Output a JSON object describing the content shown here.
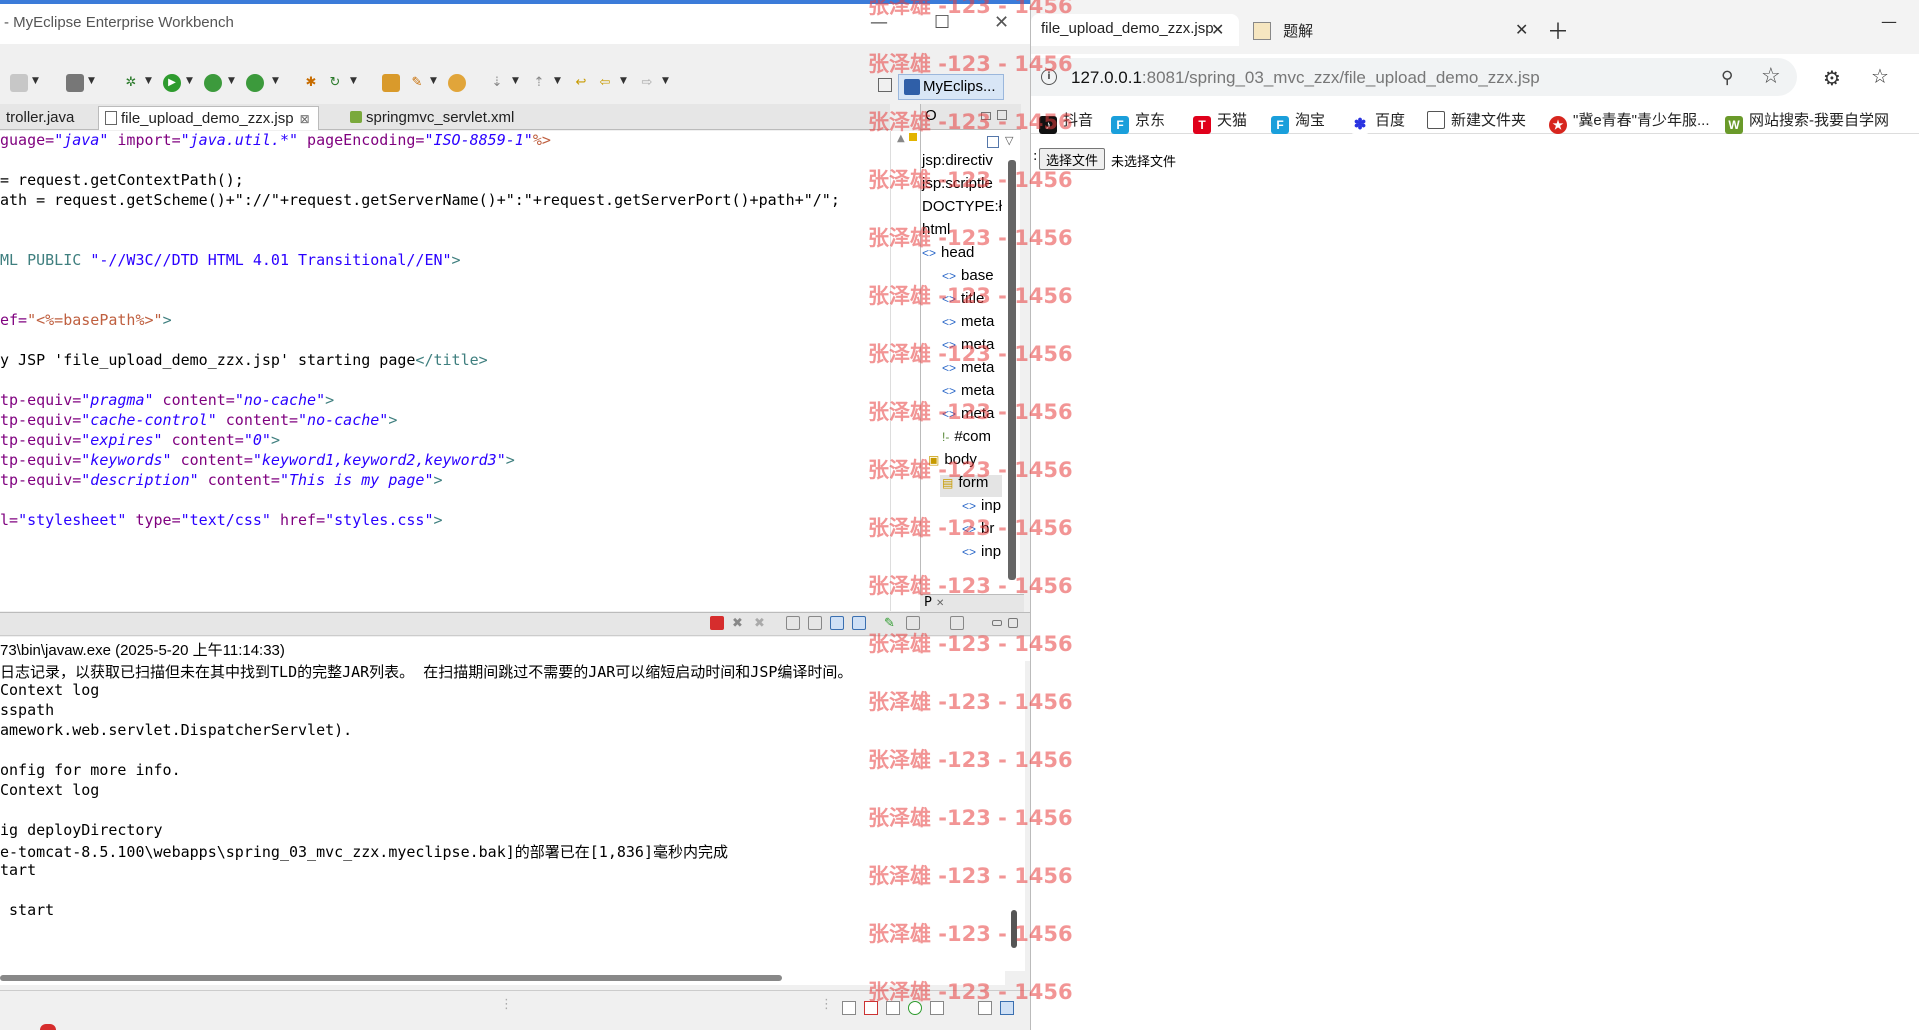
{
  "eclipse": {
    "title": "MyEclipse Enterprise Workbench",
    "perspective_label": "MyEclips...",
    "tabs": [
      {
        "label": "troller.java"
      },
      {
        "label": "file_upload_demo_zzx.jsp"
      },
      {
        "label": "springmvc_servlet.xml"
      }
    ],
    "outline_title": "O",
    "outline_items": [
      "jsp:directiv",
      "jsp:scriptle",
      "DOCTYPE:ł",
      "html",
      "head",
      "base",
      "title",
      "meta",
      "meta",
      "meta",
      "meta",
      "meta",
      "#com",
      "body",
      "form",
      "inp",
      "br",
      "inp"
    ],
    "bottom_tab": "P",
    "console_header": "73\\bin\\javaw.exe (2025-5-20 上午11:14:33)",
    "console_lines": [
      "日志记录，以获取已扫描但未在其中找到TLD的完整JAR列表。 在扫描期间跳过不需要的JAR可以缩短启动时间和JSP编译时间。",
      "Context log",
      "sspath",
      "amework.web.servlet.DispatcherServlet).",
      "",
      "onfig for more info.",
      "Context log",
      "",
      "ig deployDirectory",
      "e-tomcat-8.5.100\\webapps\\spring_03_mvc_zzx.myeclipse.bak]的部署已在[1,836]毫秒内完成",
      "tart",
      "",
      " start"
    ]
  },
  "code": {
    "l1": {
      "a": "guage=",
      "b": "\"java\"",
      "c": " import=",
      "d": "\"java.util.*\"",
      "e": " pageEncoding=",
      "f": "\"ISO-8859-1\"",
      "g": "%>"
    },
    "l2": "= request.getContextPath();",
    "l3": "ath = request.getScheme()+\"://\"+request.getServerName()+\":\"+request.getServerPort()+path+\"/\";",
    "l4": {
      "a": "ML PUBLIC ",
      "b": "\"-//W3C//DTD HTML 4.01 Transitional//EN\"",
      "c": ">"
    },
    "l5": {
      "a": "ef=",
      "b": "\"<%=basePath%>\"",
      "c": ">"
    },
    "l6": {
      "a": "y JSP 'file_upload_demo_zzx.jsp' starting page",
      "b": "</title>"
    },
    "l7": {
      "a": "tp-equiv=",
      "b": "\"pragma\"",
      "c": " content=",
      "d": "\"no-cache\"",
      "e": ">"
    },
    "l8": {
      "a": "tp-equiv=",
      "b": "\"cache-control\"",
      "c": " content=",
      "d": "\"no-cache\"",
      "e": ">"
    },
    "l9": {
      "a": "tp-equiv=",
      "b": "\"expires\"",
      "c": " content=",
      "d": "\"0\"",
      "e": ">"
    },
    "l10": {
      "a": "tp-equiv=",
      "b": "\"keywords\"",
      "c": " content=",
      "d": "\"keyword1,keyword2,keyword3\"",
      "e": ">"
    },
    "l11": {
      "a": "tp-equiv=",
      "b": "\"description\"",
      "c": " content=",
      "d": "\"This is my page\"",
      "e": ">"
    },
    "l12": {
      "a": "l=",
      "b": "\"stylesheet\"",
      "c": " type=",
      "d": "\"text/css\"",
      "e": " href=",
      "f": "\"styles.css\"",
      "g": ">"
    }
  },
  "browser": {
    "tabs": [
      {
        "label": "file_upload_demo_zzx.jsp"
      },
      {
        "label": "题解"
      }
    ],
    "url_host": "127.0.0.1",
    "url_rest": ":8081/spring_03_mvc_zzx/file_upload_demo_zzx.jsp",
    "bookmarks": [
      {
        "label": "抖音",
        "icon": "tiktok-icon",
        "color": "#111111"
      },
      {
        "label": "京东",
        "icon": "jd-icon",
        "color": "#1a9fdb"
      },
      {
        "label": "天猫",
        "icon": "tmall-icon",
        "color": "#e0001b"
      },
      {
        "label": "淘宝",
        "icon": "taobao-icon",
        "color": "#1a9fdb"
      },
      {
        "label": "百度",
        "icon": "baidu-icon",
        "color": "#2932e1"
      },
      {
        "label": "新建文件夹",
        "icon": "folder-icon",
        "color": "#555555"
      },
      {
        "label": "\"冀e青春\"青少年服...",
        "icon": "league-icon",
        "color": "#d7261e"
      },
      {
        "label": "网站搜索-我要自学网",
        "icon": "zxw-icon",
        "color": "#6a9a2a"
      }
    ],
    "file_button": "选择文件",
    "file_status": "未选择文件"
  },
  "watermark": "张泽雄 -123 - 1456"
}
